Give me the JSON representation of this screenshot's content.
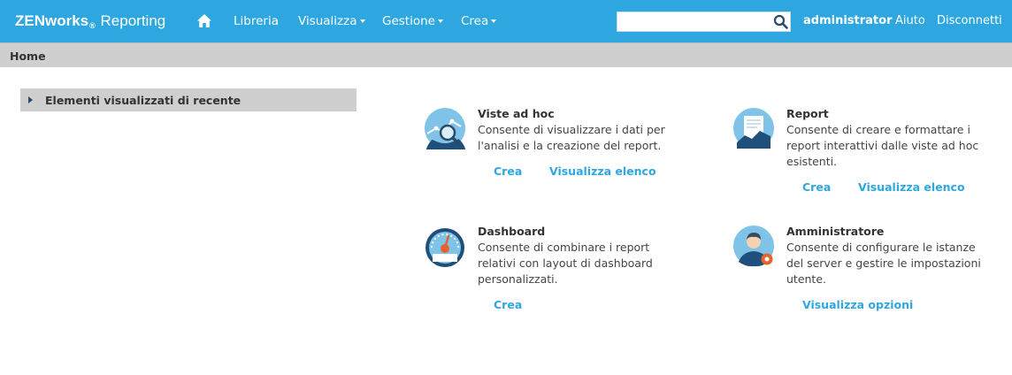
{
  "brand": {
    "name": "ZENworks",
    "registered": "®",
    "product": "Reporting"
  },
  "nav": {
    "libreria": "Libreria",
    "visualizza": "Visualizza",
    "gestione": "Gestione",
    "crea": "Crea"
  },
  "search": {
    "value": "",
    "placeholder": ""
  },
  "user": {
    "name": "administrator",
    "help": "Aiuto",
    "logout": "Disconnetti"
  },
  "breadcrumb": {
    "current": "Home"
  },
  "recent": {
    "title": "Elementi visualizzati di recente"
  },
  "cards": {
    "adhoc": {
      "title": "Viste ad hoc",
      "description": "Consente di visualizzare i dati per l'analisi e la creazione del report.",
      "action_create": "Crea",
      "action_list": "Visualizza elenco"
    },
    "report": {
      "title": "Report",
      "description": "Consente di creare e formattare i report interattivi dalle viste ad hoc esistenti.",
      "action_create": "Crea",
      "action_list": "Visualizza elenco"
    },
    "dashboard": {
      "title": "Dashboard",
      "description": "Consente di combinare i report relativi con layout di dashboard personalizzati.",
      "action_create": "Crea"
    },
    "admin": {
      "title": "Amministratore",
      "description": "Consente di configurare le istanze del server e gestire le impostazioni utente.",
      "action_options": "Visualizza opzioni"
    }
  },
  "colors": {
    "topbar": "#2ea7e0",
    "link": "#2ea7e0",
    "breadcrumb": "#cfcfcf",
    "icon_circle": "#7fc4e8",
    "icon_dark": "#1f4f7a"
  }
}
